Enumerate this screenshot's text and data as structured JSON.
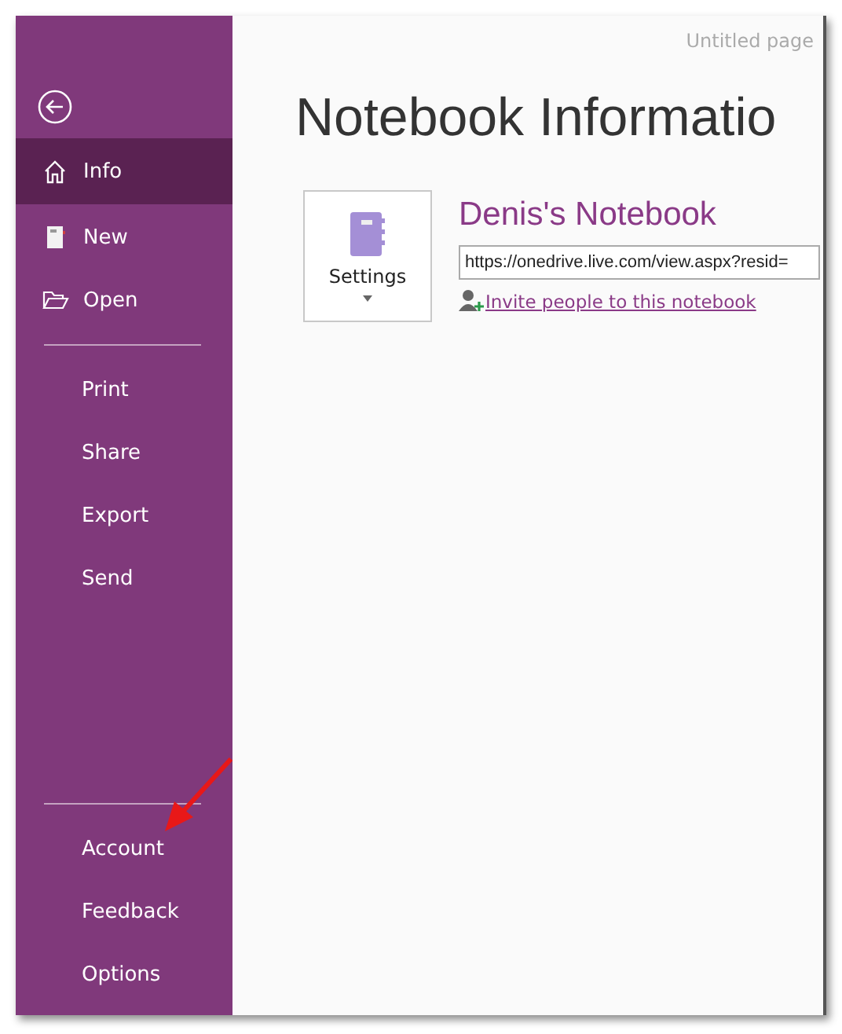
{
  "sidebar": {
    "sections": [
      [
        {
          "label": "Info",
          "selected": true
        },
        {
          "label": "New",
          "selected": false
        },
        {
          "label": "Open",
          "selected": false
        }
      ],
      [
        {
          "label": "Print",
          "selected": false
        },
        {
          "label": "Share",
          "selected": false
        },
        {
          "label": "Export",
          "selected": false
        },
        {
          "label": "Send",
          "selected": false
        }
      ],
      [
        {
          "label": "Account",
          "selected": false
        },
        {
          "label": "Feedback",
          "selected": false
        },
        {
          "label": "Options",
          "selected": false
        }
      ]
    ]
  },
  "page_name": "Untitled page",
  "title": "Notebook Informatio",
  "notebook": {
    "settings_label": "Settings",
    "name": "Denis's Notebook",
    "url": "https://onedrive.live.com/view.aspx?resid=",
    "invite_link": "Invite people to this notebook"
  },
  "annotation": {
    "kind": "arrow"
  }
}
